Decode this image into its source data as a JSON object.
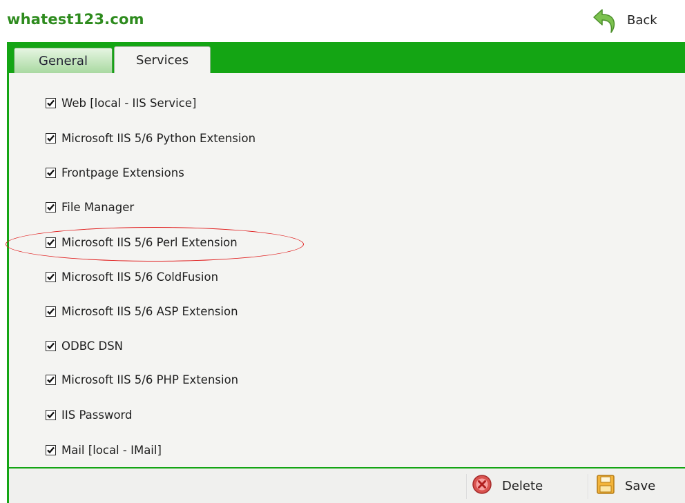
{
  "header": {
    "site_title": "whatest123.com",
    "back_label": "Back"
  },
  "tabs": [
    {
      "label": "General",
      "active": false
    },
    {
      "label": "Services",
      "active": true
    }
  ],
  "services": [
    {
      "label": "Web [local - IIS Service]",
      "checked": true
    },
    {
      "label": "Microsoft IIS 5/6 Python Extension",
      "checked": true
    },
    {
      "label": "Frontpage Extensions",
      "checked": true
    },
    {
      "label": "File Manager",
      "checked": true
    },
    {
      "label": "Microsoft IIS 5/6 Perl Extension",
      "checked": true,
      "highlighted": true
    },
    {
      "label": "Microsoft IIS 5/6 ColdFusion",
      "checked": true
    },
    {
      "label": "Microsoft IIS 5/6 ASP Extension",
      "checked": true
    },
    {
      "label": "ODBC DSN",
      "checked": true
    },
    {
      "label": "Microsoft IIS 5/6 PHP Extension",
      "checked": true
    },
    {
      "label": "IIS Password",
      "checked": true
    },
    {
      "label": "Mail [local - IMail]",
      "checked": true
    }
  ],
  "footer": {
    "delete_label": "Delete",
    "save_label": "Save"
  },
  "colors": {
    "accent_green": "#14a514",
    "title_green": "#2e8b1e",
    "highlight_red": "#e01a1a"
  },
  "icons": {
    "back": "back-arrow-icon",
    "delete": "delete-icon",
    "save": "save-icon",
    "check": "checkmark-icon"
  }
}
